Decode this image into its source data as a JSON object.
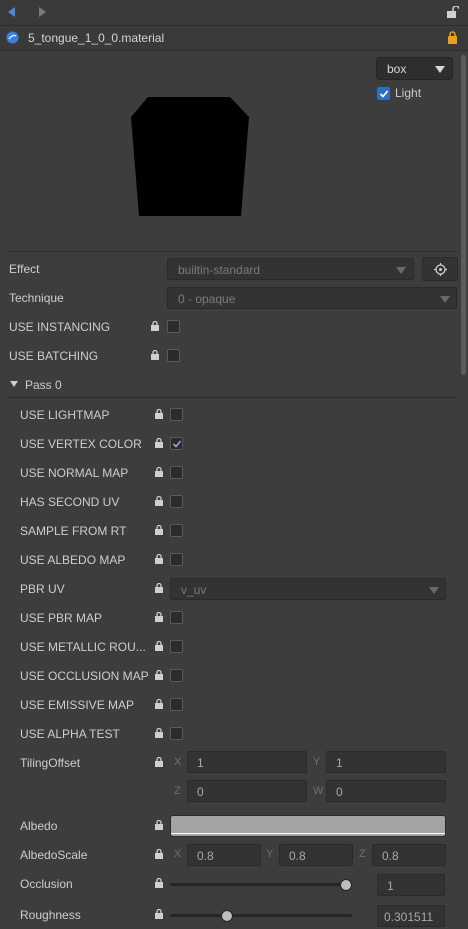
{
  "header": {
    "file_name": "5_tongue_1_0_0.material"
  },
  "preview": {
    "shape_select": "box",
    "light_label": "Light",
    "light_checked": true
  },
  "main": {
    "effect": {
      "label": "Effect",
      "value": "builtin-standard"
    },
    "technique": {
      "label": "Technique",
      "value": "0 - opaque"
    },
    "use_instancing": {
      "label": "USE INSTANCING",
      "checked": false
    },
    "use_batching": {
      "label": "USE BATCHING",
      "checked": false
    }
  },
  "pass": {
    "title": "Pass 0",
    "props": [
      {
        "label": "USE LIGHTMAP",
        "checked": false
      },
      {
        "label": "USE VERTEX COLOR",
        "checked": true
      },
      {
        "label": "USE NORMAL MAP",
        "checked": false
      },
      {
        "label": "HAS SECOND UV",
        "checked": false
      },
      {
        "label": "SAMPLE FROM RT",
        "checked": false
      },
      {
        "label": "USE ALBEDO MAP",
        "checked": false
      }
    ],
    "pbr_uv": {
      "label": "PBR UV",
      "value": "v_uv"
    },
    "props2": [
      {
        "label": "USE PBR MAP",
        "checked": false
      },
      {
        "label": "USE METALLIC ROU...",
        "checked": false
      },
      {
        "label": "USE OCCLUSION MAP",
        "checked": false
      },
      {
        "label": "USE EMISSIVE MAP",
        "checked": false
      },
      {
        "label": "USE ALPHA TEST",
        "checked": false
      }
    ],
    "tiling_offset": {
      "label": "TilingOffset",
      "x_axis": "X",
      "x": "1",
      "y_axis": "Y",
      "y": "1",
      "z_axis": "Z",
      "z": "0",
      "w_axis": "W",
      "w": "0"
    },
    "albedo": {
      "label": "Albedo",
      "color": "#a3a3a3"
    },
    "albedo_scale": {
      "label": "AlbedoScale",
      "x_axis": "X",
      "x": "0.8",
      "y_axis": "Y",
      "y": "0.8",
      "z_axis": "Z",
      "z": "0.8"
    },
    "occlusion": {
      "label": "Occlusion",
      "value": "1",
      "fraction": 1.0
    },
    "roughness": {
      "label": "Roughness",
      "value": "0.301511",
      "fraction": 0.301511
    }
  },
  "colors": {
    "accent": "#2f6fc1",
    "lock": "#e8a21a"
  }
}
